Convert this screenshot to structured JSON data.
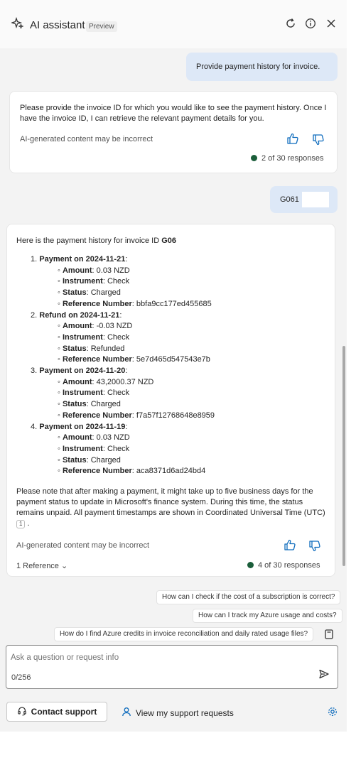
{
  "header": {
    "title": "AI assistant",
    "badge": "Preview"
  },
  "chat": {
    "user_msg_1": "Provide payment history for invoice.",
    "assistant_1": {
      "text": "Please provide the invoice ID for which you would like to see the payment history. Once I have the invoice ID, I can retrieve the relevant payment details for you.",
      "disclaimer": "AI-generated content may be incorrect",
      "responses": "2 of 30 responses"
    },
    "user_msg_2": "G061",
    "assistant_2": {
      "intro_prefix": "Here is the payment history for invoice ID ",
      "intro_id": "G06",
      "payments": [
        {
          "num": "1.",
          "title": "Payment on 2024-11-21",
          "amount": "0.03 NZD",
          "instrument": "Check",
          "status": "Charged",
          "reference": "bbfa9cc177ed455685"
        },
        {
          "num": "2.",
          "title": "Refund on 2024-11-21",
          "amount": "-0.03 NZD",
          "instrument": "Check",
          "status": "Refunded",
          "reference": "5e7d465d547543e7b"
        },
        {
          "num": "3.",
          "title": "Payment on 2024-11-20",
          "amount": "43,2000.37 NZD",
          "instrument": "Check",
          "status": "Charged",
          "reference": "f7a57f12768648e8959"
        },
        {
          "num": "4.",
          "title": "Payment on 2024-11-19",
          "amount": "0.03 NZD",
          "instrument": "Check",
          "status": "Charged",
          "reference": "aca8371d6ad24bd4"
        }
      ],
      "labels": {
        "amount": "Amount",
        "instrument": "Instrument",
        "status": "Status",
        "reference": "Reference Number"
      },
      "note": "Please note that after making a payment, it might take up to five business days for the payment status to update in Microsoft's finance system. During this time, the status remains unpaid. All payment timestamps are shown in Coordinated Universal Time (UTC)",
      "footnote": "1",
      "disclaimer": "AI-generated content may be incorrect",
      "references": "1 Reference",
      "responses": "4 of 30 responses"
    }
  },
  "suggestions": [
    "How can I check if the cost of a subscription is correct?",
    "How can I track my Azure usage and costs?",
    "How do I find Azure credits in invoice reconciliation and daily rated usage files?"
  ],
  "input": {
    "placeholder": "Ask a question or request info",
    "counter": "0/256"
  },
  "footer": {
    "contact_support": "Contact support",
    "view_requests": "View my support requests"
  },
  "icons": {
    "sparkle": "sparkle-icon",
    "refresh": "refresh-icon",
    "info": "info-icon",
    "close": "close-icon",
    "thumbs_up": "thumbs-up-icon",
    "thumbs_down": "thumbs-down-icon",
    "send": "send-icon",
    "headset": "headset-icon",
    "person": "person-icon",
    "settings": "gear-icon",
    "notebook": "notebook-icon"
  },
  "colors": {
    "user_bubble": "#dde8f7",
    "response_dot": "#1b5e3a",
    "accent_blue": "#0f6cbd"
  }
}
